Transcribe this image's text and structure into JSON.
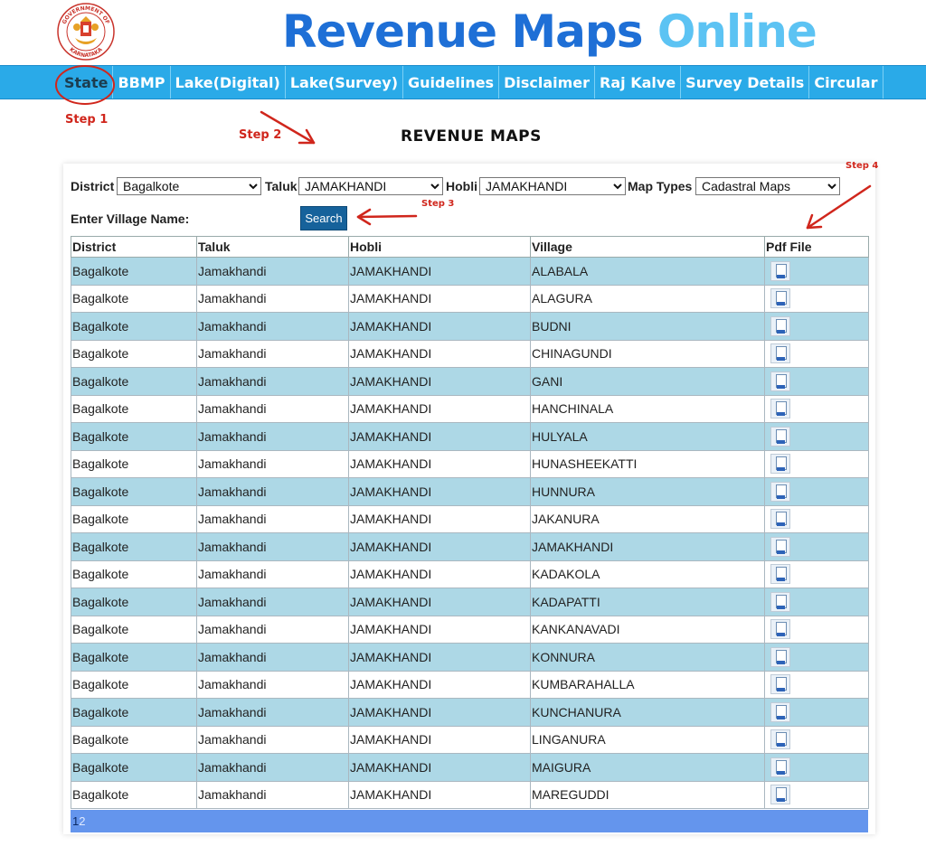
{
  "header": {
    "title_part1": "Revenue Maps",
    "title_part2": "Online",
    "emblem_text_top": "GOVERNMENT OF",
    "emblem_text_bottom": "KARNATAKA"
  },
  "nav": {
    "items": [
      "State",
      "BBMP",
      "Lake(Digital)",
      "Lake(Survey)",
      "Guidelines",
      "Disclaimer",
      "Raj Kalve",
      "Survey Details",
      "Circular"
    ],
    "active_index": 0
  },
  "annotations": {
    "step1": "Step 1",
    "step2": "Step 2",
    "step3": "Step 3",
    "step4": "Step 4",
    "color": "#d0261c"
  },
  "page_heading": "REVENUE MAPS",
  "filters": {
    "district_label": "District",
    "district_value": "Bagalkote",
    "taluk_label": "Taluk",
    "taluk_value": "JAMAKHANDI",
    "hobli_label": "Hobli",
    "hobli_value": "JAMAKHANDI",
    "map_types_label": "Map Types",
    "map_types_value": "Cadastral Maps",
    "village_label": "Enter Village Name:",
    "village_value": "",
    "search_label": "Search"
  },
  "table": {
    "headers": [
      "District",
      "Taluk",
      "Hobli",
      "Village",
      "Pdf File"
    ],
    "rows": [
      [
        "Bagalkote",
        "Jamakhandi",
        "JAMAKHANDI",
        "ALABALA"
      ],
      [
        "Bagalkote",
        "Jamakhandi",
        "JAMAKHANDI",
        "ALAGURA"
      ],
      [
        "Bagalkote",
        "Jamakhandi",
        "JAMAKHANDI",
        "BUDNI"
      ],
      [
        "Bagalkote",
        "Jamakhandi",
        "JAMAKHANDI",
        "CHINAGUNDI"
      ],
      [
        "Bagalkote",
        "Jamakhandi",
        "JAMAKHANDI",
        "GANI"
      ],
      [
        "Bagalkote",
        "Jamakhandi",
        "JAMAKHANDI",
        "HANCHINALA"
      ],
      [
        "Bagalkote",
        "Jamakhandi",
        "JAMAKHANDI",
        "HULYALA"
      ],
      [
        "Bagalkote",
        "Jamakhandi",
        "JAMAKHANDI",
        "HUNASHEEKATTI"
      ],
      [
        "Bagalkote",
        "Jamakhandi",
        "JAMAKHANDI",
        "HUNNURA"
      ],
      [
        "Bagalkote",
        "Jamakhandi",
        "JAMAKHANDI",
        "JAKANURA"
      ],
      [
        "Bagalkote",
        "Jamakhandi",
        "JAMAKHANDI",
        "JAMAKHANDI"
      ],
      [
        "Bagalkote",
        "Jamakhandi",
        "JAMAKHANDI",
        "KADAKOLA"
      ],
      [
        "Bagalkote",
        "Jamakhandi",
        "JAMAKHANDI",
        "KADAPATTI"
      ],
      [
        "Bagalkote",
        "Jamakhandi",
        "JAMAKHANDI",
        "KANKANAVADI"
      ],
      [
        "Bagalkote",
        "Jamakhandi",
        "JAMAKHANDI",
        "KONNURA"
      ],
      [
        "Bagalkote",
        "Jamakhandi",
        "JAMAKHANDI",
        "KUMBARAHALLA"
      ],
      [
        "Bagalkote",
        "Jamakhandi",
        "JAMAKHANDI",
        "KUNCHANURA"
      ],
      [
        "Bagalkote",
        "Jamakhandi",
        "JAMAKHANDI",
        "LINGANURA"
      ],
      [
        "Bagalkote",
        "Jamakhandi",
        "JAMAKHANDI",
        "MAIGURA"
      ],
      [
        "Bagalkote",
        "Jamakhandi",
        "JAMAKHANDI",
        "MAREGUDDI"
      ]
    ],
    "pdf_icon": "pdf-file-icon"
  },
  "pager": {
    "current": "1",
    "next": "2"
  },
  "colors": {
    "navbar": "#2aaae8",
    "title_dark": "#1e6fd6",
    "title_light": "#5cc3f3",
    "row_alt": "#add8e6",
    "pager": "#6495ed",
    "search_button": "#16629b"
  }
}
